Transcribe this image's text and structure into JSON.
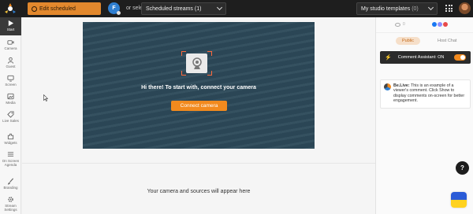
{
  "topbar": {
    "edit_label": "Edit scheduled",
    "avatar_letter": "F",
    "select_from": "or select from",
    "streams": {
      "label": "Scheduled streams",
      "count": "(1)"
    },
    "templates": {
      "label": "My studio templates",
      "count": "(0)"
    }
  },
  "sidebar": {
    "items": [
      {
        "label": "Start",
        "icon": "play-icon"
      },
      {
        "label": "Camera",
        "icon": "camera-icon"
      },
      {
        "label": "Guest",
        "icon": "guest-icon"
      },
      {
        "label": "Screen",
        "icon": "screen-icon"
      },
      {
        "label": "Media",
        "icon": "media-icon"
      },
      {
        "label": "Live Sales",
        "icon": "tag-icon"
      },
      {
        "label": "Widgets",
        "icon": "widgets-icon"
      },
      {
        "label": "On Screen Agenda",
        "icon": "agenda-icon"
      },
      {
        "label": "Branding",
        "icon": "brush-icon"
      },
      {
        "label": "Stream Settings",
        "icon": "gear-icon"
      }
    ]
  },
  "preview": {
    "headline": "Hi there! To start with, connect your camera",
    "connect_button": "Connect camera"
  },
  "stage": {
    "sources_text": "Your camera and sources will appear here"
  },
  "right_panel": {
    "viewers": "0",
    "tabs": [
      "Public",
      "Host Chat"
    ],
    "assistant_label": "Comment Assistant: ON",
    "comment": {
      "author": "Be.Live:",
      "text": "This is an example of a viewer's comment. Click Show to display comments on-screen for better engagement."
    }
  },
  "colors": {
    "accent": "#f28a1e",
    "preview_bg": "#2d4a5a",
    "topbar_bg": "#1e1e1e"
  }
}
